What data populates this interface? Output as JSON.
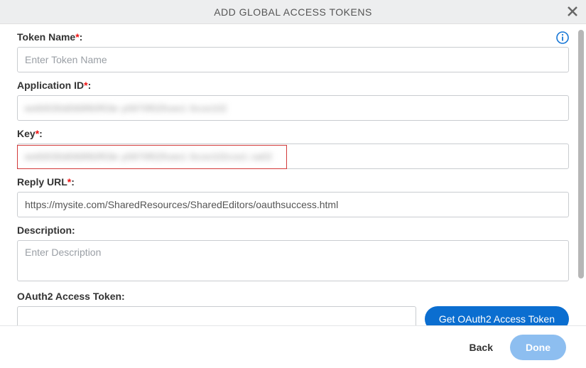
{
  "header": {
    "title": "ADD GLOBAL ACCESS TOKENS"
  },
  "fields": {
    "tokenName": {
      "label": "Token Name",
      "placeholder": "Enter Token Name",
      "value": ""
    },
    "applicationId": {
      "label": "Application ID",
      "masked": "ee60030d069f60f03e y0970f02fcee1 0cce102"
    },
    "key": {
      "label": "Key",
      "masked": "ee60030d069f60f03e y0970f02fcee1 0cce102cce1 ca02"
    },
    "replyUrl": {
      "label": "Reply URL",
      "value": "https://mysite.com/SharedResources/SharedEditors/oauthsuccess.html"
    },
    "description": {
      "label": "Description",
      "placeholder": "Enter Description",
      "value": ""
    },
    "oauthToken": {
      "label": "OAuth2 Access Token",
      "value": ""
    }
  },
  "buttons": {
    "getOauth": "Get OAuth2 Access Token",
    "back": "Back",
    "done": "Done"
  },
  "punct": {
    "colon": ":",
    "star": "*"
  }
}
